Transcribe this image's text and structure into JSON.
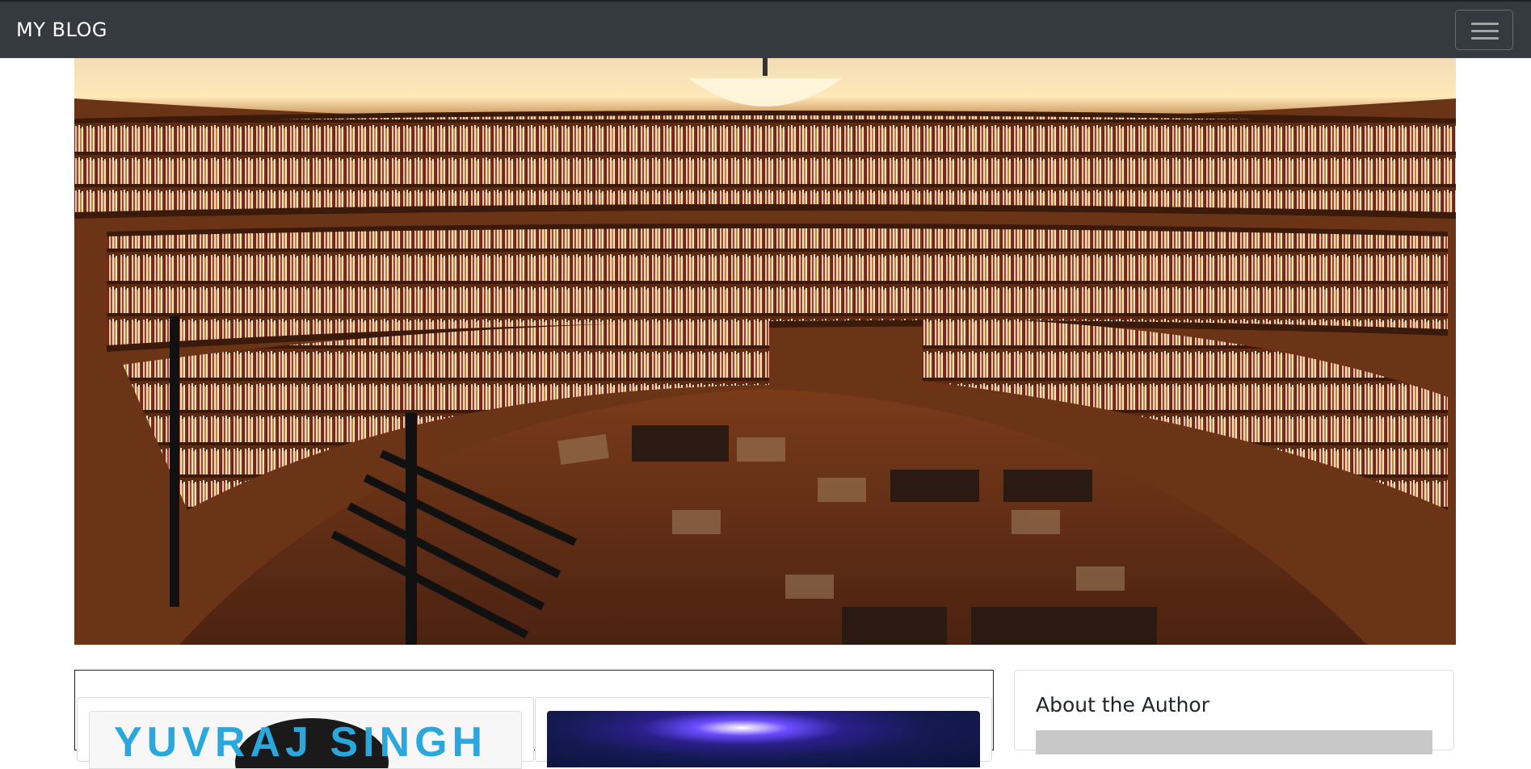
{
  "navbar": {
    "brand": "MY BLOG",
    "background": "#343a40"
  },
  "hero": {
    "image": "library-interior-photo",
    "alt": ""
  },
  "posts": [
    {
      "thumbnail": "yuvraj-singh-photo",
      "thumbnail_text": "YUVRAJ SINGH"
    },
    {
      "thumbnail": "blue-light-burst-image"
    }
  ],
  "sidebar": {
    "title": "About the Author"
  },
  "icons": {
    "menu_toggle": "hamburger-menu-icon"
  }
}
